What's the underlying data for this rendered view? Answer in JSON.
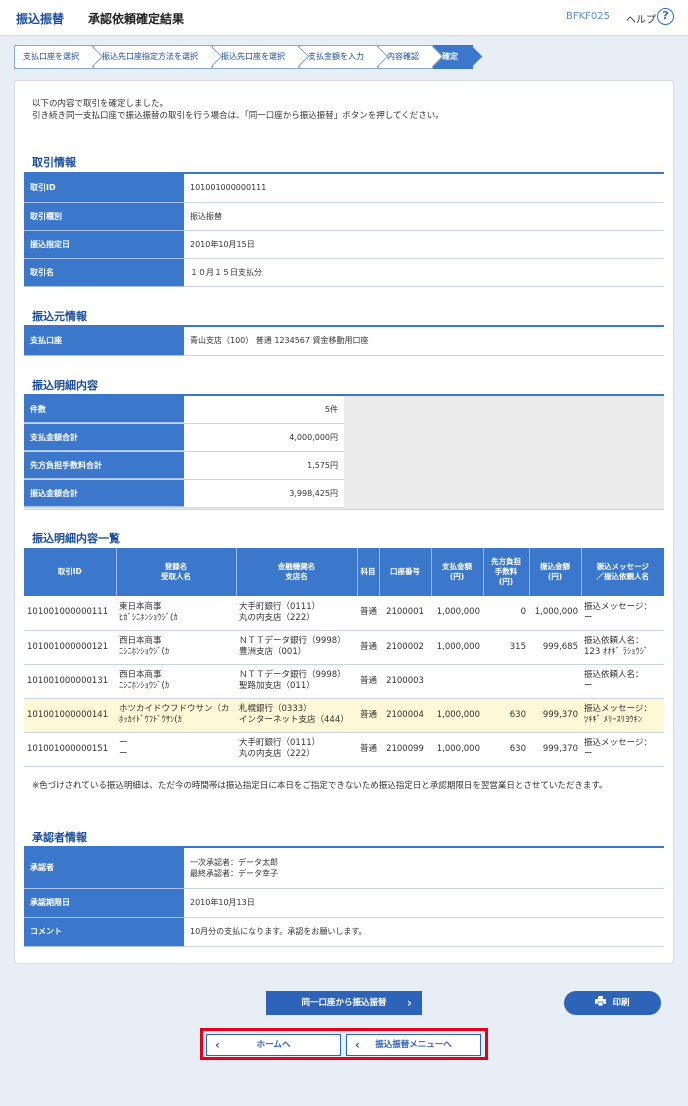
{
  "header": {
    "app_name": "振込振替",
    "page_title": "承認依頼確定結果",
    "screen_code": "BFKF025",
    "help_label": "ヘルプ",
    "help_icon": "?"
  },
  "steps": [
    "支払口座を選択",
    "振込先口座指定方法を選択",
    "振込先口座を選択",
    "支払金額を入力",
    "内容確認",
    "確定"
  ],
  "intro": {
    "line1": "以下の内容で取引を確定しました。",
    "line2": "引き続き同一支払口座で振込振替の取引を行う場合は、「同一口座から振込振替」ボタンを押してください。"
  },
  "transaction": {
    "title": "取引情報",
    "rows": [
      {
        "label": "取引ID",
        "value": "101001000000111"
      },
      {
        "label": "取引種別",
        "value": "振込振替"
      },
      {
        "label": "振込指定日",
        "value": "2010年10月15日"
      },
      {
        "label": "取引名",
        "value": "１０月１５日支払分"
      }
    ]
  },
  "source": {
    "title": "振込元情報",
    "label": "支払口座",
    "value": "青山支店（100） 普通 1234567 資金移動用口座"
  },
  "summary": {
    "title": "振込明細内容",
    "rows": [
      {
        "label": "件数",
        "value": "5件"
      },
      {
        "label": "支払金額合計",
        "value": "4,000,000円"
      },
      {
        "label": "先方負担手数料合計",
        "value": "1,575円"
      },
      {
        "label": "振込金額合計",
        "value": "3,998,425円"
      }
    ]
  },
  "detail": {
    "title": "振込明細内容一覧",
    "headers": {
      "id": "取引ID",
      "reg1": "登録名",
      "reg2": "受取人名",
      "bank1": "金融機関名",
      "bank2": "支店名",
      "type": "科目",
      "acct": "口座番号",
      "amt1": "支払金額",
      "amt2": "(円)",
      "fee1": "先方負担",
      "fee2": "手数料",
      "fee3": "(円)",
      "xfer1": "振込金額",
      "xfer2": "(円)",
      "msg1": "振込メッセージ",
      "msg2": "／振込依頼人名"
    },
    "rows": [
      {
        "id": "101001000000111",
        "name1": "東日本商事",
        "name2": "ﾋｶﾞｼﾆﾎﾝｼｮｳｼﾞ(ｶ",
        "bank1": "大手町銀行（0111）",
        "bank2": "丸の内支店（222）",
        "type": "普通",
        "acct": "2100001",
        "amount": "1,000,000",
        "fee": "0",
        "transfer": "1,000,000",
        "msg1": "振込メッセージ：",
        "msg2": "ー"
      },
      {
        "id": "101001000000121",
        "name1": "西日本商事",
        "name2": "ﾆｼﾆﾎﾝｼｮｳｼﾞ(ｶ",
        "bank1": "ＮＴＴデータ銀行（9998）",
        "bank2": "豊洲支店（001）",
        "type": "普通",
        "acct": "2100002",
        "amount": "1,000,000",
        "fee": "315",
        "transfer": "999,685",
        "msg1": "振込依頼人名：",
        "msg2": "123 ｵｵｷﾞ ﾗｼｮｳｼﾞ"
      },
      {
        "id": "101001000000131",
        "name1": "西日本商事",
        "name2": "ﾆｼﾆﾎﾝｼｮｳｼﾞ(ｶ",
        "bank1": "ＮＴＴデータ銀行（9998）",
        "bank2": "聖路加支店（011）",
        "type": "普通",
        "acct": "2100003",
        "amount": "",
        "fee": "",
        "transfer": "",
        "msg1": "振込依頼人名：",
        "msg2": "ー"
      },
      {
        "id": "101001000000141",
        "name1": "ホツカイドウフドウサン（カ",
        "name2": "ﾎｯｶｲﾄﾞｳﾌﾄﾞｳｻﾝ(ｶ",
        "bank1": "札幌銀行（0333）",
        "bank2": "インターネット支店（444）",
        "type": "普通",
        "acct": "2100004",
        "amount": "1,000,000",
        "fee": "630",
        "transfer": "999,370",
        "msg1": "振込メッセージ：",
        "msg2": "ﾂｷｷﾞ ﾒﾘｰｽﾘﾖｳｷﾝ"
      },
      {
        "id": "101001000000151",
        "name1": "ー",
        "name2": "ー",
        "bank1": "大手町銀行（0111）",
        "bank2": "丸の内支店（222）",
        "type": "普通",
        "acct": "2100099",
        "amount": "1,000,000",
        "fee": "630",
        "transfer": "999,370",
        "msg1": "振込メッセージ：",
        "msg2": "ー"
      }
    ]
  },
  "note": "※色づけされている振込明細は、ただ今の時間帯は振込指定日に本日をご指定できないため振込指定日と承認期限日を翌営業日とさせていただきます。",
  "approver": {
    "title": "承認者情報",
    "approver_label": "承認者",
    "approver_line1": "一次承認者：データ太郎",
    "approver_line2": "最終承認者：データ幸子",
    "deadline_label": "承認期限日",
    "deadline_value": "2010年10月13日",
    "comment_label": "コメント",
    "comment_value": "10月分の支払になります。承認をお願いします。"
  },
  "buttons": {
    "same_account": "同一口座から振込振替",
    "print": "印刷",
    "home": "ホームへ",
    "transfer_menu": "振込振替メニューへ"
  },
  "colors": {
    "accent": "#3b78cc",
    "highlight_row": "#fdf9d6",
    "focus_border": "#e4001b"
  }
}
